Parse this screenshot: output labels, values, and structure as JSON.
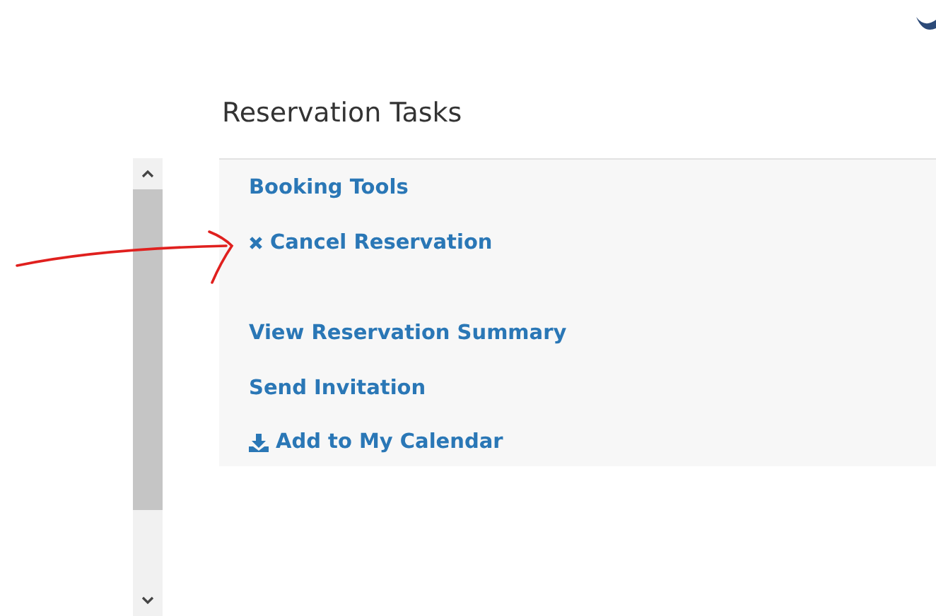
{
  "section": {
    "title": "Reservation Tasks"
  },
  "task_groups": [
    {
      "tasks": [
        {
          "label": "Booking Tools",
          "kind": "plain"
        },
        {
          "label": "Cancel Reservation",
          "kind": "cancel"
        }
      ]
    },
    {
      "tasks": [
        {
          "label": "View Reservation Summary",
          "kind": "plain"
        },
        {
          "label": "Send Invitation",
          "kind": "plain"
        },
        {
          "label": "Add to My Calendar",
          "kind": "download"
        }
      ]
    }
  ]
}
